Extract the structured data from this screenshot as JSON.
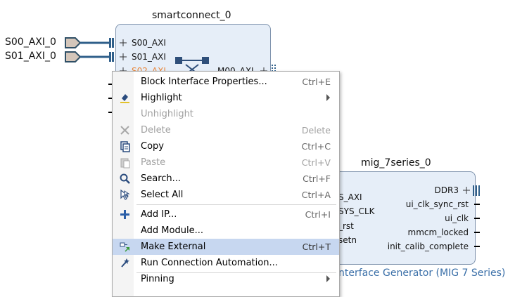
{
  "canvas": {
    "external_ports": [
      "S00_AXI_0",
      "S01_AXI_0"
    ],
    "smartconnect": {
      "title": "smartconnect_0",
      "left_ports": [
        "S00_AXI",
        "S01_AXI",
        "S02_AXI"
      ],
      "right_port": "M00_AXI"
    },
    "mig": {
      "title": "mig_7series_0",
      "left_ports_partial": [
        "S_AXI",
        "SYS_CLK",
        "_rst",
        "setn"
      ],
      "right_ports": [
        "DDR3",
        "ui_clk_sync_rst",
        "ui_clk",
        "mmcm_locked",
        "init_calib_complete"
      ],
      "subtitle": "nterface Generator (MIG 7 Series)"
    }
  },
  "context_menu": {
    "items": [
      {
        "label": "Block Interface Properties...",
        "shortcut": "Ctrl+E",
        "icon": "none",
        "enabled": true
      },
      {
        "label": "Highlight",
        "shortcut": "",
        "icon": "highlight-icon",
        "enabled": true,
        "submenu": true
      },
      {
        "label": "Unhighlight",
        "shortcut": "",
        "icon": "none",
        "enabled": false
      },
      {
        "label": "Delete",
        "shortcut": "Delete",
        "icon": "delete-icon",
        "enabled": false
      },
      {
        "label": "Copy",
        "shortcut": "Ctrl+C",
        "icon": "copy-icon",
        "enabled": true
      },
      {
        "label": "Paste",
        "shortcut": "Ctrl+V",
        "icon": "paste-icon",
        "enabled": false
      },
      {
        "label": "Search...",
        "shortcut": "Ctrl+F",
        "icon": "search-icon",
        "enabled": true
      },
      {
        "label": "Select All",
        "shortcut": "Ctrl+A",
        "icon": "select-all-icon",
        "enabled": true
      },
      {
        "label": "Add IP...",
        "shortcut": "Ctrl+I",
        "icon": "add-icon",
        "enabled": true
      },
      {
        "label": "Add Module...",
        "shortcut": "",
        "icon": "none",
        "enabled": true
      },
      {
        "label": "Make External",
        "shortcut": "Ctrl+T",
        "icon": "make-external-icon",
        "enabled": true,
        "active": true
      },
      {
        "label": "Run Connection Automation...",
        "shortcut": "",
        "icon": "automation-icon",
        "enabled": true
      },
      {
        "label": "Pinning",
        "shortcut": "",
        "icon": "none",
        "enabled": true,
        "submenu": true
      }
    ]
  },
  "colors": {
    "block_fill": "#e6eef8",
    "block_border": "#7f93ad",
    "bus_line": "#2f5f8a",
    "menu_highlight": "#c7d7f0",
    "port_orange": "#e8863a"
  }
}
